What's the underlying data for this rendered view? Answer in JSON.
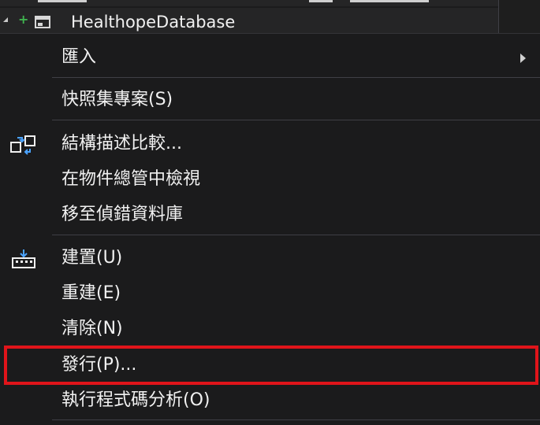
{
  "tree": {
    "project_title": "HealthopeDatabase"
  },
  "menu": {
    "items": [
      {
        "label": "匯入",
        "has_submenu": true
      },
      {
        "label": "快照集專案(S)"
      },
      {
        "label": "結構描述比較...",
        "icon": "schema-compare-icon"
      },
      {
        "label": "在物件總管中檢視"
      },
      {
        "label": "移至偵錯資料庫"
      },
      {
        "label": "建置(U)",
        "icon": "build-icon"
      },
      {
        "label": "重建(E)"
      },
      {
        "label": "清除(N)"
      },
      {
        "label": "發行(P)...",
        "highlighted": true
      },
      {
        "label": "執行程式碼分析(O)"
      }
    ]
  },
  "colors": {
    "menu_background": "#1b1b1c",
    "text": "#f1f1f1",
    "separator": "#3f3f46",
    "highlight_border": "#e0141a",
    "icon_blue": "#4aa3ff",
    "add_green": "#3fb34f"
  }
}
